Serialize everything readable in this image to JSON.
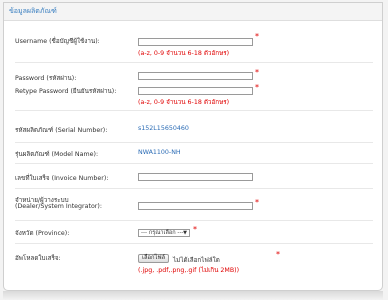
{
  "panel": {
    "title": "ข้อมูลผลิตภัณฑ์"
  },
  "form": {
    "username": {
      "label": "Username (ชื่อบัญชีผู้ใช้งาน):",
      "value": "",
      "hint": "(a-z, 0-9 จำนวน 6-18 ตัวอักษร)"
    },
    "password": {
      "label": "Password (รหัสผ่าน):",
      "value": ""
    },
    "retype_password": {
      "label": "Retype Password (ยืนยันรหัสผ่าน):",
      "value": "",
      "hint": "(a-z, 0-9 จำนวน 6-18 ตัวอักษร)"
    },
    "serial_number": {
      "label": "รหัสผลิตภัณฑ์ (Serial Number):",
      "value": "s152L15650460"
    },
    "model_name": {
      "label": "รุ่นผลิตภัณฑ์ (Model Name):",
      "value": "NWA1100-NH"
    },
    "invoice_number": {
      "label": "เลขที่ใบเสร็จ (Invoice Number):",
      "value": ""
    },
    "dealer": {
      "label_line1": "จำหน่าย/ผู้วางระบบ",
      "label_line2": "(Dealer/System Integrator):",
      "value": ""
    },
    "province": {
      "label": "จังหวัด (Province):",
      "selected": "--- กรุณาเลือก ---",
      "arrow": "▼"
    },
    "receipt": {
      "label": "อัพโหลดใบเสร็จ:",
      "button_label": "เลือกไฟล์",
      "no_file_text": "ไม่ได้เลือกไฟล์ใด",
      "hint": "(.jpg, .pdf,.png,.gif (ไม่เกิน 2MB))"
    },
    "required_mark": "*"
  },
  "colors": {
    "accent": "#3a7fc0",
    "required": "#e00000",
    "value": "#2a6bb5"
  }
}
